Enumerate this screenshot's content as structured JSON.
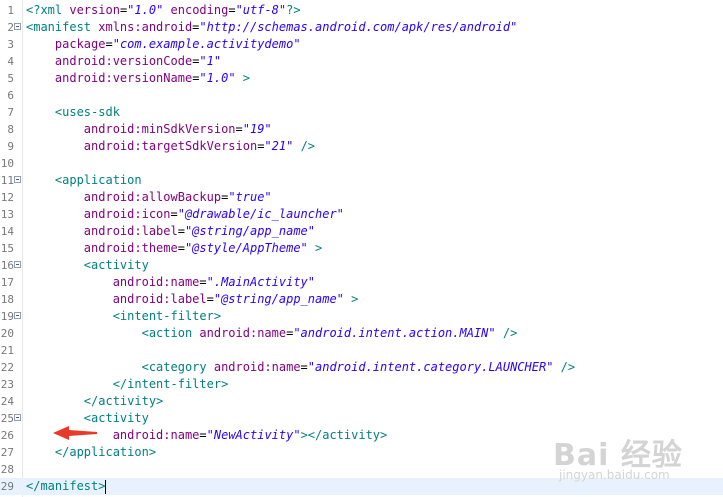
{
  "editor": {
    "lines": [
      {
        "no": "1",
        "segs": [
          [
            "t",
            "<?xml "
          ],
          [
            "a",
            "version"
          ],
          [
            "p",
            "="
          ],
          [
            "v",
            "\"1.0\""
          ],
          [
            "p",
            " "
          ],
          [
            "a",
            "encoding"
          ],
          [
            "p",
            "="
          ],
          [
            "v",
            "\"utf-8\""
          ],
          [
            "t",
            "?>"
          ]
        ]
      },
      {
        "no": "2",
        "fold": true,
        "segs": [
          [
            "t",
            "<manifest "
          ],
          [
            "a",
            "xmlns:android"
          ],
          [
            "p",
            "="
          ],
          [
            "v",
            "\"http://schemas.android.com/apk/res/android\""
          ]
        ]
      },
      {
        "no": "3",
        "segs": [
          [
            "p",
            "    "
          ],
          [
            "a",
            "package"
          ],
          [
            "p",
            "="
          ],
          [
            "v",
            "\"com.example.activitydemo\""
          ]
        ]
      },
      {
        "no": "4",
        "segs": [
          [
            "p",
            "    "
          ],
          [
            "a",
            "android:versionCode"
          ],
          [
            "p",
            "="
          ],
          [
            "v",
            "\"1\""
          ]
        ]
      },
      {
        "no": "5",
        "segs": [
          [
            "p",
            "    "
          ],
          [
            "a",
            "android:versionName"
          ],
          [
            "p",
            "="
          ],
          [
            "v",
            "\"1.0\""
          ],
          [
            "p",
            " "
          ],
          [
            "t",
            ">"
          ]
        ]
      },
      {
        "no": "6",
        "segs": []
      },
      {
        "no": "7",
        "segs": [
          [
            "p",
            "    "
          ],
          [
            "t",
            "<uses-sdk"
          ]
        ]
      },
      {
        "no": "8",
        "segs": [
          [
            "p",
            "        "
          ],
          [
            "a",
            "android:minSdkVersion"
          ],
          [
            "p",
            "="
          ],
          [
            "v",
            "\"19\""
          ]
        ]
      },
      {
        "no": "9",
        "segs": [
          [
            "p",
            "        "
          ],
          [
            "a",
            "android:targetSdkVersion"
          ],
          [
            "p",
            "="
          ],
          [
            "v",
            "\"21\""
          ],
          [
            "p",
            " "
          ],
          [
            "t",
            "/>"
          ]
        ]
      },
      {
        "no": "10",
        "segs": []
      },
      {
        "no": "11",
        "fold": true,
        "segs": [
          [
            "p",
            "    "
          ],
          [
            "t",
            "<application"
          ]
        ]
      },
      {
        "no": "12",
        "segs": [
          [
            "p",
            "        "
          ],
          [
            "a",
            "android:allowBackup"
          ],
          [
            "p",
            "="
          ],
          [
            "v",
            "\"true\""
          ]
        ]
      },
      {
        "no": "13",
        "segs": [
          [
            "p",
            "        "
          ],
          [
            "a",
            "android:icon"
          ],
          [
            "p",
            "="
          ],
          [
            "v",
            "\"@drawable/ic_launcher\""
          ]
        ]
      },
      {
        "no": "14",
        "segs": [
          [
            "p",
            "        "
          ],
          [
            "a",
            "android:label"
          ],
          [
            "p",
            "="
          ],
          [
            "v",
            "\"@string/app_name\""
          ]
        ]
      },
      {
        "no": "15",
        "segs": [
          [
            "p",
            "        "
          ],
          [
            "a",
            "android:theme"
          ],
          [
            "p",
            "="
          ],
          [
            "v",
            "\"@style/AppTheme\""
          ],
          [
            "p",
            " "
          ],
          [
            "t",
            ">"
          ]
        ]
      },
      {
        "no": "16",
        "fold": true,
        "segs": [
          [
            "p",
            "        "
          ],
          [
            "t",
            "<activity"
          ]
        ]
      },
      {
        "no": "17",
        "segs": [
          [
            "p",
            "            "
          ],
          [
            "a",
            "android:name"
          ],
          [
            "p",
            "="
          ],
          [
            "v",
            "\".MainActivity\""
          ]
        ]
      },
      {
        "no": "18",
        "segs": [
          [
            "p",
            "            "
          ],
          [
            "a",
            "android:label"
          ],
          [
            "p",
            "="
          ],
          [
            "v",
            "\"@string/app_name\""
          ],
          [
            "p",
            " "
          ],
          [
            "t",
            ">"
          ]
        ]
      },
      {
        "no": "19",
        "fold": true,
        "segs": [
          [
            "p",
            "            "
          ],
          [
            "t",
            "<intent-filter>"
          ]
        ]
      },
      {
        "no": "20",
        "segs": [
          [
            "p",
            "                "
          ],
          [
            "t",
            "<action "
          ],
          [
            "a",
            "android:name"
          ],
          [
            "p",
            "="
          ],
          [
            "v",
            "\"android.intent.action.MAIN\""
          ],
          [
            "p",
            " "
          ],
          [
            "t",
            "/>"
          ]
        ]
      },
      {
        "no": "21",
        "segs": []
      },
      {
        "no": "22",
        "segs": [
          [
            "p",
            "                "
          ],
          [
            "t",
            "<category "
          ],
          [
            "a",
            "android:name"
          ],
          [
            "p",
            "="
          ],
          [
            "v",
            "\"android.intent.category.LAUNCHER\""
          ],
          [
            "p",
            " "
          ],
          [
            "t",
            "/>"
          ]
        ]
      },
      {
        "no": "23",
        "segs": [
          [
            "p",
            "            "
          ],
          [
            "t",
            "</intent-filter>"
          ]
        ]
      },
      {
        "no": "24",
        "segs": [
          [
            "p",
            "        "
          ],
          [
            "t",
            "</activity>"
          ]
        ]
      },
      {
        "no": "25",
        "fold": true,
        "segs": [
          [
            "p",
            "        "
          ],
          [
            "t",
            "<activity"
          ]
        ]
      },
      {
        "no": "26",
        "segs": [
          [
            "p",
            "            "
          ],
          [
            "a",
            "android:name"
          ],
          [
            "p",
            "="
          ],
          [
            "v",
            "\"NewActivity\""
          ],
          [
            "t",
            "></activity>"
          ]
        ]
      },
      {
        "no": "27",
        "segs": [
          [
            "p",
            "    "
          ],
          [
            "t",
            "</application>"
          ]
        ]
      },
      {
        "no": "28",
        "segs": []
      },
      {
        "no": "29",
        "current": true,
        "cursor": true,
        "segs": [
          [
            "t",
            "</manifest>"
          ]
        ]
      }
    ]
  },
  "annotation": {
    "icon": "red-arrow-icon",
    "color": "#e8392b"
  },
  "watermark": {
    "main": "Bai 经验",
    "sub": "jingyan.baidu.com"
  }
}
